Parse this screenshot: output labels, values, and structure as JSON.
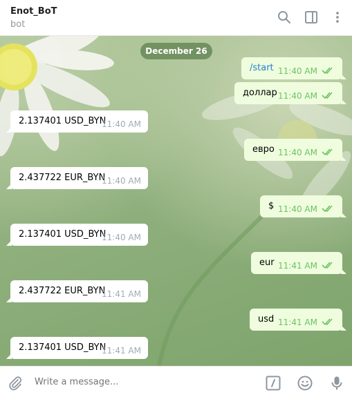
{
  "header": {
    "title": "Enot_BoT",
    "subtitle": "bot",
    "icons": [
      "search-icon",
      "sidebar-toggle-icon",
      "more-vert-icon"
    ]
  },
  "chat": {
    "date": "December 26",
    "messages": [
      {
        "dir": "out",
        "text": "/start",
        "time": "11:40 AM",
        "read": true,
        "is_command": true
      },
      {
        "dir": "out",
        "text": "доллар",
        "time": "11:40 AM",
        "read": true
      },
      {
        "dir": "in",
        "text": "2.137401 USD_BYN",
        "time": "11:40 AM"
      },
      {
        "dir": "out",
        "text": "евро",
        "time": "11:40 AM",
        "read": true
      },
      {
        "dir": "in",
        "text": "2.437722 EUR_BYN",
        "time": "11:40 AM"
      },
      {
        "dir": "out",
        "text": "$",
        "time": "11:40 AM",
        "read": true
      },
      {
        "dir": "in",
        "text": "2.137401 USD_BYN",
        "time": "11:40 AM"
      },
      {
        "dir": "out",
        "text": "eur",
        "time": "11:41 AM",
        "read": true
      },
      {
        "dir": "in",
        "text": "2.437722 EUR_BYN",
        "time": "11:41 AM"
      },
      {
        "dir": "out",
        "text": "usd",
        "time": "11:41 AM",
        "read": true
      },
      {
        "dir": "in",
        "text": "2.137401 USD_BYN",
        "time": "11:41 AM"
      }
    ]
  },
  "composer": {
    "placeholder": "Write a message...",
    "icons": [
      "attach-icon",
      "bot-command-icon",
      "emoji-icon",
      "microphone-icon"
    ]
  },
  "colors": {
    "outgoing_bubble": "#effdde",
    "incoming_bubble": "#ffffff",
    "read_check": "#6cc264",
    "command_link": "#2481cc"
  }
}
